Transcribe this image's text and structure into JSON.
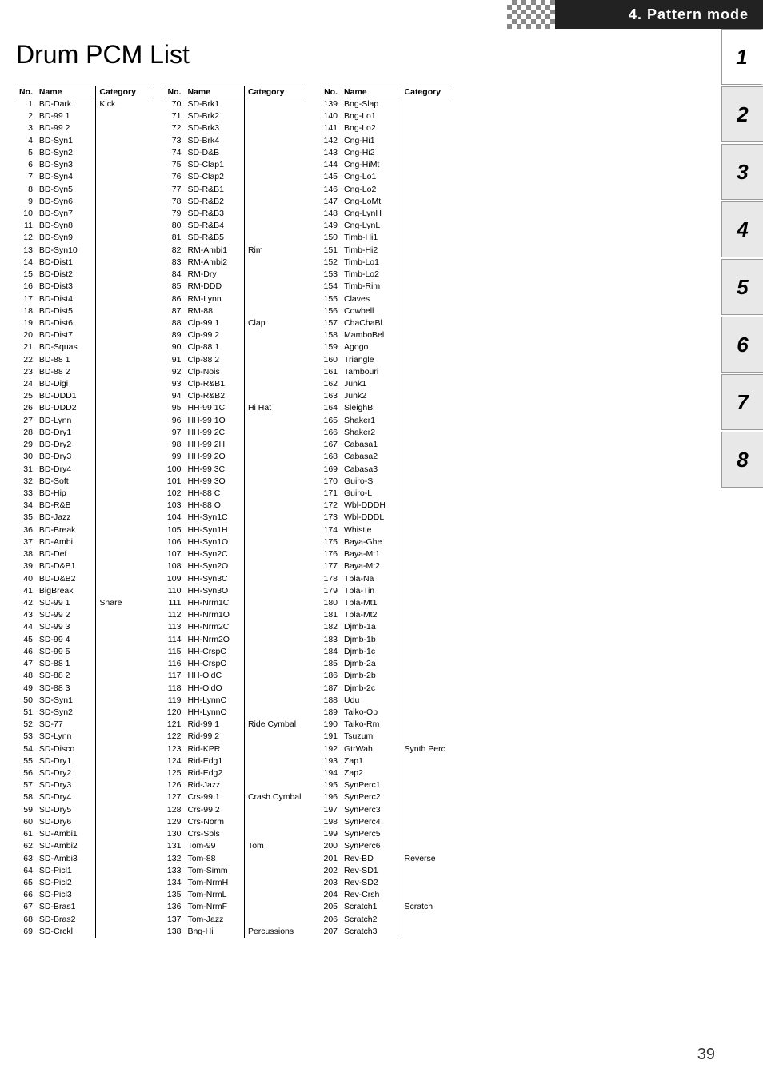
{
  "header": {
    "title": "4. Pattern mode"
  },
  "page": {
    "title": "Drum PCM List",
    "number": "39"
  },
  "side_tabs": [
    {
      "label": "1",
      "active": true
    },
    {
      "label": "2",
      "active": false
    },
    {
      "label": "3",
      "active": false
    },
    {
      "label": "4",
      "active": false
    },
    {
      "label": "5",
      "active": false
    },
    {
      "label": "6",
      "active": false
    },
    {
      "label": "7",
      "active": false
    },
    {
      "label": "8",
      "active": false
    }
  ],
  "col1": {
    "headers": [
      "No.",
      "Name",
      "Category"
    ],
    "rows": [
      [
        "1",
        "BD-Dark",
        "Kick"
      ],
      [
        "2",
        "BD-99 1",
        ""
      ],
      [
        "3",
        "BD-99 2",
        ""
      ],
      [
        "4",
        "BD-Syn1",
        ""
      ],
      [
        "5",
        "BD-Syn2",
        ""
      ],
      [
        "6",
        "BD-Syn3",
        ""
      ],
      [
        "7",
        "BD-Syn4",
        ""
      ],
      [
        "8",
        "BD-Syn5",
        ""
      ],
      [
        "9",
        "BD-Syn6",
        ""
      ],
      [
        "10",
        "BD-Syn7",
        ""
      ],
      [
        "11",
        "BD-Syn8",
        ""
      ],
      [
        "12",
        "BD-Syn9",
        ""
      ],
      [
        "13",
        "BD-Syn10",
        ""
      ],
      [
        "14",
        "BD-Dist1",
        ""
      ],
      [
        "15",
        "BD-Dist2",
        ""
      ],
      [
        "16",
        "BD-Dist3",
        ""
      ],
      [
        "17",
        "BD-Dist4",
        ""
      ],
      [
        "18",
        "BD-Dist5",
        ""
      ],
      [
        "19",
        "BD-Dist6",
        ""
      ],
      [
        "20",
        "BD-Dist7",
        ""
      ],
      [
        "21",
        "BD-Squas",
        ""
      ],
      [
        "22",
        "BD-88 1",
        ""
      ],
      [
        "23",
        "BD-88 2",
        ""
      ],
      [
        "24",
        "BD-Digi",
        ""
      ],
      [
        "25",
        "BD-DDD1",
        ""
      ],
      [
        "26",
        "BD-DDD2",
        ""
      ],
      [
        "27",
        "BD-Lynn",
        ""
      ],
      [
        "28",
        "BD-Dry1",
        ""
      ],
      [
        "29",
        "BD-Dry2",
        ""
      ],
      [
        "30",
        "BD-Dry3",
        ""
      ],
      [
        "31",
        "BD-Dry4",
        ""
      ],
      [
        "32",
        "BD-Soft",
        ""
      ],
      [
        "33",
        "BD-Hip",
        ""
      ],
      [
        "34",
        "BD-R&B",
        ""
      ],
      [
        "35",
        "BD-Jazz",
        ""
      ],
      [
        "36",
        "BD-Break",
        ""
      ],
      [
        "37",
        "BD-Ambi",
        ""
      ],
      [
        "38",
        "BD-Def",
        ""
      ],
      [
        "39",
        "BD-D&B1",
        ""
      ],
      [
        "40",
        "BD-D&B2",
        ""
      ],
      [
        "41",
        "BigBreak",
        ""
      ],
      [
        "42",
        "SD-99 1",
        "Snare"
      ],
      [
        "43",
        "SD-99 2",
        ""
      ],
      [
        "44",
        "SD-99 3",
        ""
      ],
      [
        "45",
        "SD-99 4",
        ""
      ],
      [
        "46",
        "SD-99 5",
        ""
      ],
      [
        "47",
        "SD-88 1",
        ""
      ],
      [
        "48",
        "SD-88 2",
        ""
      ],
      [
        "49",
        "SD-88 3",
        ""
      ],
      [
        "50",
        "SD-Syn1",
        ""
      ],
      [
        "51",
        "SD-Syn2",
        ""
      ],
      [
        "52",
        "SD-77",
        ""
      ],
      [
        "53",
        "SD-Lynn",
        ""
      ],
      [
        "54",
        "SD-Disco",
        ""
      ],
      [
        "55",
        "SD-Dry1",
        ""
      ],
      [
        "56",
        "SD-Dry2",
        ""
      ],
      [
        "57",
        "SD-Dry3",
        ""
      ],
      [
        "58",
        "SD-Dry4",
        ""
      ],
      [
        "59",
        "SD-Dry5",
        ""
      ],
      [
        "60",
        "SD-Dry6",
        ""
      ],
      [
        "61",
        "SD-Ambi1",
        ""
      ],
      [
        "62",
        "SD-Ambi2",
        ""
      ],
      [
        "63",
        "SD-Ambi3",
        ""
      ],
      [
        "64",
        "SD-Picl1",
        ""
      ],
      [
        "65",
        "SD-Picl2",
        ""
      ],
      [
        "66",
        "SD-Picl3",
        ""
      ],
      [
        "67",
        "SD-Bras1",
        ""
      ],
      [
        "68",
        "SD-Bras2",
        ""
      ],
      [
        "69",
        "SD-Crckl",
        ""
      ]
    ]
  },
  "col2": {
    "headers": [
      "No.",
      "Name",
      "Category"
    ],
    "rows": [
      [
        "70",
        "SD-Brk1",
        ""
      ],
      [
        "71",
        "SD-Brk2",
        ""
      ],
      [
        "72",
        "SD-Brk3",
        ""
      ],
      [
        "73",
        "SD-Brk4",
        ""
      ],
      [
        "74",
        "SD-D&B",
        ""
      ],
      [
        "75",
        "SD-Clap1",
        ""
      ],
      [
        "76",
        "SD-Clap2",
        ""
      ],
      [
        "77",
        "SD-R&B1",
        ""
      ],
      [
        "78",
        "SD-R&B2",
        ""
      ],
      [
        "79",
        "SD-R&B3",
        ""
      ],
      [
        "80",
        "SD-R&B4",
        ""
      ],
      [
        "81",
        "SD-R&B5",
        ""
      ],
      [
        "82",
        "RM-Ambi1",
        "Rim"
      ],
      [
        "83",
        "RM-Ambi2",
        ""
      ],
      [
        "84",
        "RM-Dry",
        ""
      ],
      [
        "85",
        "RM-DDD",
        ""
      ],
      [
        "86",
        "RM-Lynn",
        ""
      ],
      [
        "87",
        "RM-88",
        ""
      ],
      [
        "88",
        "Clp-99 1",
        "Clap"
      ],
      [
        "89",
        "Clp-99 2",
        ""
      ],
      [
        "90",
        "Clp-88 1",
        ""
      ],
      [
        "91",
        "Clp-88 2",
        ""
      ],
      [
        "92",
        "Clp-Nois",
        ""
      ],
      [
        "93",
        "Clp-R&B1",
        ""
      ],
      [
        "94",
        "Clp-R&B2",
        ""
      ],
      [
        "95",
        "HH-99 1C",
        "Hi Hat"
      ],
      [
        "96",
        "HH-99 1O",
        ""
      ],
      [
        "97",
        "HH-99 2C",
        ""
      ],
      [
        "98",
        "HH-99 2H",
        ""
      ],
      [
        "99",
        "HH-99 2O",
        ""
      ],
      [
        "100",
        "HH-99 3C",
        ""
      ],
      [
        "101",
        "HH-99 3O",
        ""
      ],
      [
        "102",
        "HH-88 C",
        ""
      ],
      [
        "103",
        "HH-88 O",
        ""
      ],
      [
        "104",
        "HH-Syn1C",
        ""
      ],
      [
        "105",
        "HH-Syn1H",
        ""
      ],
      [
        "106",
        "HH-Syn1O",
        ""
      ],
      [
        "107",
        "HH-Syn2C",
        ""
      ],
      [
        "108",
        "HH-Syn2O",
        ""
      ],
      [
        "109",
        "HH-Syn3C",
        ""
      ],
      [
        "110",
        "HH-Syn3O",
        ""
      ],
      [
        "111",
        "HH-Nrm1C",
        ""
      ],
      [
        "112",
        "HH-Nrm1O",
        ""
      ],
      [
        "113",
        "HH-Nrm2C",
        ""
      ],
      [
        "114",
        "HH-Nrm2O",
        ""
      ],
      [
        "115",
        "HH-CrspC",
        ""
      ],
      [
        "116",
        "HH-CrspO",
        ""
      ],
      [
        "117",
        "HH-OldC",
        ""
      ],
      [
        "118",
        "HH-OldO",
        ""
      ],
      [
        "119",
        "HH-LynnC",
        ""
      ],
      [
        "120",
        "HH-LynnO",
        ""
      ],
      [
        "121",
        "Rid-99 1",
        "Ride Cymbal"
      ],
      [
        "122",
        "Rid-99 2",
        ""
      ],
      [
        "123",
        "Rid-KPR",
        ""
      ],
      [
        "124",
        "Rid-Edg1",
        ""
      ],
      [
        "125",
        "Rid-Edg2",
        ""
      ],
      [
        "126",
        "Rid-Jazz",
        ""
      ],
      [
        "127",
        "Crs-99 1",
        "Crash Cymbal"
      ],
      [
        "128",
        "Crs-99 2",
        ""
      ],
      [
        "129",
        "Crs-Norm",
        ""
      ],
      [
        "130",
        "Crs-Spls",
        ""
      ],
      [
        "131",
        "Tom-99",
        "Tom"
      ],
      [
        "132",
        "Tom-88",
        ""
      ],
      [
        "133",
        "Tom-Simm",
        ""
      ],
      [
        "134",
        "Tom-NrmH",
        ""
      ],
      [
        "135",
        "Tom-NrmL",
        ""
      ],
      [
        "136",
        "Tom-NrmF",
        ""
      ],
      [
        "137",
        "Tom-Jazz",
        ""
      ],
      [
        "138",
        "Bng-Hi",
        "Percussions"
      ]
    ]
  },
  "col3": {
    "headers": [
      "No.",
      "Name",
      "Category"
    ],
    "rows": [
      [
        "139",
        "Bng-Slap",
        ""
      ],
      [
        "140",
        "Bng-Lo1",
        ""
      ],
      [
        "141",
        "Bng-Lo2",
        ""
      ],
      [
        "142",
        "Cng-Hi1",
        ""
      ],
      [
        "143",
        "Cng-Hi2",
        ""
      ],
      [
        "144",
        "Cng-HiMt",
        ""
      ],
      [
        "145",
        "Cng-Lo1",
        ""
      ],
      [
        "146",
        "Cng-Lo2",
        ""
      ],
      [
        "147",
        "Cng-LoMt",
        ""
      ],
      [
        "148",
        "Cng-LynH",
        ""
      ],
      [
        "149",
        "Cng-LynL",
        ""
      ],
      [
        "150",
        "Timb-Hi1",
        ""
      ],
      [
        "151",
        "Timb-Hi2",
        ""
      ],
      [
        "152",
        "Timb-Lo1",
        ""
      ],
      [
        "153",
        "Timb-Lo2",
        ""
      ],
      [
        "154",
        "Timb-Rim",
        ""
      ],
      [
        "155",
        "Claves",
        ""
      ],
      [
        "156",
        "Cowbell",
        ""
      ],
      [
        "157",
        "ChaChaBl",
        ""
      ],
      [
        "158",
        "MamboBel",
        ""
      ],
      [
        "159",
        "Agogo",
        ""
      ],
      [
        "160",
        "Triangle",
        ""
      ],
      [
        "161",
        "Tambouri",
        ""
      ],
      [
        "162",
        "Junk1",
        ""
      ],
      [
        "163",
        "Junk2",
        ""
      ],
      [
        "164",
        "SleighBl",
        ""
      ],
      [
        "165",
        "Shaker1",
        ""
      ],
      [
        "166",
        "Shaker2",
        ""
      ],
      [
        "167",
        "Cabasa1",
        ""
      ],
      [
        "168",
        "Cabasa2",
        ""
      ],
      [
        "169",
        "Cabasa3",
        ""
      ],
      [
        "170",
        "Guiro-S",
        ""
      ],
      [
        "171",
        "Guiro-L",
        ""
      ],
      [
        "172",
        "Wbl-DDDH",
        ""
      ],
      [
        "173",
        "Wbl-DDDL",
        ""
      ],
      [
        "174",
        "Whistle",
        ""
      ],
      [
        "175",
        "Baya-Ghe",
        ""
      ],
      [
        "176",
        "Baya-Mt1",
        ""
      ],
      [
        "177",
        "Baya-Mt2",
        ""
      ],
      [
        "178",
        "Tbla-Na",
        ""
      ],
      [
        "179",
        "Tbla-Tin",
        ""
      ],
      [
        "180",
        "Tbla-Mt1",
        ""
      ],
      [
        "181",
        "Tbla-Mt2",
        ""
      ],
      [
        "182",
        "Djmb-1a",
        ""
      ],
      [
        "183",
        "Djmb-1b",
        ""
      ],
      [
        "184",
        "Djmb-1c",
        ""
      ],
      [
        "185",
        "Djmb-2a",
        ""
      ],
      [
        "186",
        "Djmb-2b",
        ""
      ],
      [
        "187",
        "Djmb-2c",
        ""
      ],
      [
        "188",
        "Udu",
        ""
      ],
      [
        "189",
        "Taiko-Op",
        ""
      ],
      [
        "190",
        "Taiko-Rm",
        ""
      ],
      [
        "191",
        "Tsuzumi",
        ""
      ],
      [
        "192",
        "GtrWah",
        "Synth Perc"
      ],
      [
        "193",
        "Zap1",
        ""
      ],
      [
        "194",
        "Zap2",
        ""
      ],
      [
        "195",
        "SynPerc1",
        ""
      ],
      [
        "196",
        "SynPerc2",
        ""
      ],
      [
        "197",
        "SynPerc3",
        ""
      ],
      [
        "198",
        "SynPerc4",
        ""
      ],
      [
        "199",
        "SynPerc5",
        ""
      ],
      [
        "200",
        "SynPerc6",
        ""
      ],
      [
        "201",
        "Rev-BD",
        "Reverse"
      ],
      [
        "202",
        "Rev-SD1",
        ""
      ],
      [
        "203",
        "Rev-SD2",
        ""
      ],
      [
        "204",
        "Rev-Crsh",
        ""
      ],
      [
        "205",
        "Scratch1",
        "Scratch"
      ],
      [
        "206",
        "Scratch2",
        ""
      ],
      [
        "207",
        "Scratch3",
        ""
      ]
    ]
  }
}
